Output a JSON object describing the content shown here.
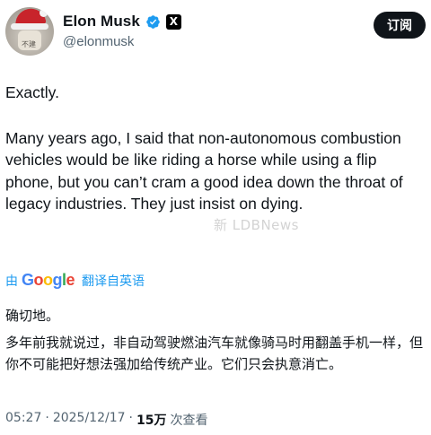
{
  "author": {
    "display_name": "Elon Musk",
    "handle": "@elonmusk",
    "avatar_text": "不建",
    "verified_icon": "verified-badge-icon",
    "affiliate_badge": "X"
  },
  "actions": {
    "subscribe_label": "订阅"
  },
  "tweet": {
    "paragraph_1": "Exactly.",
    "paragraph_2": "Many years ago, I said that non-autonomous combustion vehicles would be like riding a horse while using a flip phone, but you can’t cram a good idea down the throat of legacy industries. They just insist on dying."
  },
  "translation": {
    "by_label": "由",
    "provider": "Google",
    "link_label": "翻译自英语",
    "paragraph_1": "确切地。",
    "paragraph_2": "多年前我就说过，非自动驾驶燃油汽车就像骑马时用翻盖手机一样，但你不可能把好想法强加给传统产业。它们只会执意消亡。"
  },
  "watermark": "新 LDBNews",
  "meta": {
    "time": "05:27",
    "date": "2025/12/17",
    "separator": "·",
    "views_count": "15万",
    "views_label": "次查看"
  },
  "colors": {
    "link_blue": "#1d9bf0",
    "text_primary": "#0f1419",
    "text_secondary": "#536471",
    "button_bg": "#0f1419"
  }
}
